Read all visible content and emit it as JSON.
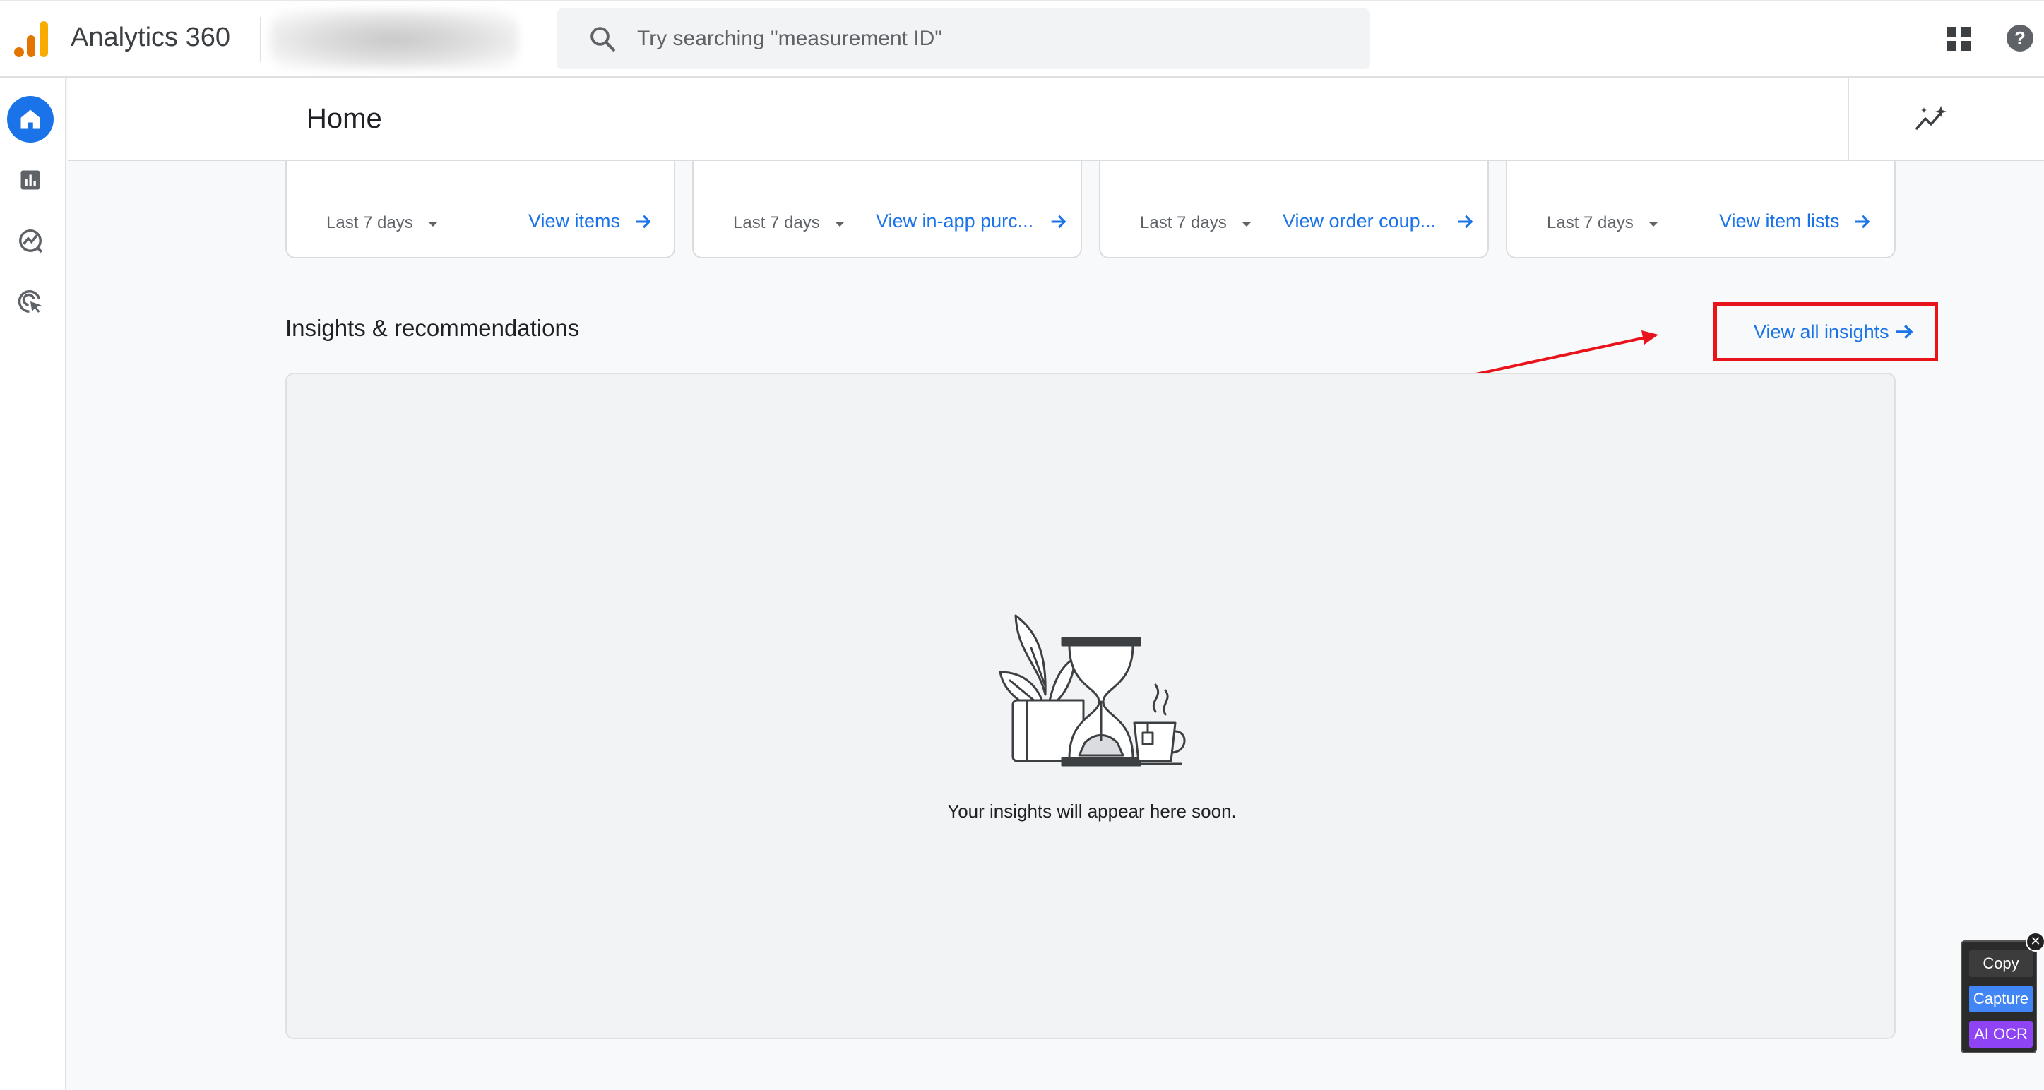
{
  "app": {
    "title": "Analytics 360",
    "logo_icon": "analytics-bars-icon",
    "brand_colors": [
      "#f9ab00",
      "#e37400"
    ]
  },
  "search": {
    "placeholder": "Try searching \"measurement ID\"",
    "icon": "search-icon"
  },
  "header_icons": {
    "apps": "apps-grid-icon",
    "help": "help-icon"
  },
  "leftnav": {
    "items": [
      {
        "name": "home",
        "icon": "home-icon",
        "active": true
      },
      {
        "name": "reports",
        "icon": "bar-chart-icon",
        "active": false
      },
      {
        "name": "explore",
        "icon": "explore-icon",
        "active": false
      },
      {
        "name": "advertising",
        "icon": "cursor-target-icon",
        "active": false
      }
    ],
    "accent": "#1a73e8"
  },
  "page": {
    "title": "Home",
    "insights_icon": "insights-sparkline-icon"
  },
  "cards": [
    {
      "range": "Last 7 days",
      "link": "View items"
    },
    {
      "range": "Last 7 days",
      "link": "View in-app purc..."
    },
    {
      "range": "Last 7 days",
      "link": "View order coup..."
    },
    {
      "range": "Last 7 days",
      "link": "View item lists"
    }
  ],
  "insights": {
    "section_title": "Insights & recommendations",
    "view_all_label": "View all insights",
    "empty_message": "Your insights will appear here soon.",
    "illustration": "hourglass-plant-cup-illustration",
    "highlight_color": "#e8131b"
  },
  "tool": {
    "copy_label": "Copy",
    "capture_label": "Capture",
    "ocr_label": "AI OCR",
    "close_label": "✕"
  }
}
